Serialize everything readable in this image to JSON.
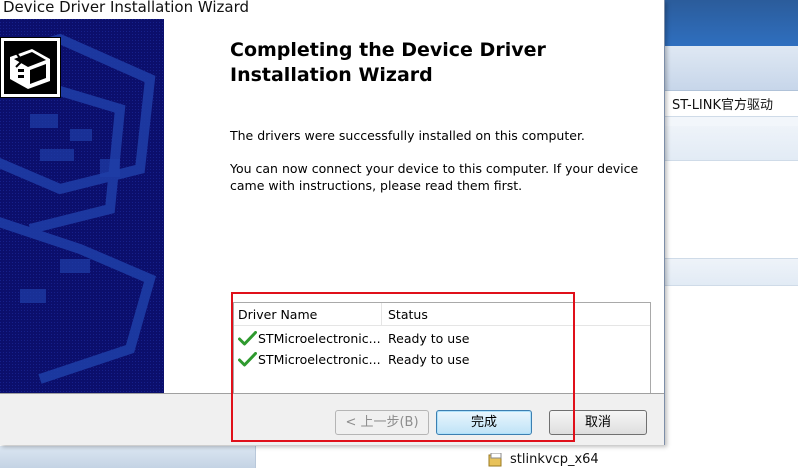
{
  "background": {
    "window_title": "ST-LINK官方驱动",
    "file_item": "stlinkvcp_x64"
  },
  "wizard": {
    "title": "Device Driver Installation Wizard",
    "heading": "Completing the Device Driver Installation Wizard",
    "paragraph1": "The drivers were successfully installed on this computer.",
    "paragraph2": "You can now connect your device to this computer. If your device came with instructions, please read them first.",
    "table": {
      "columns": [
        "Driver Name",
        "Status"
      ],
      "rows": [
        {
          "name": "STMicroelectronic...",
          "status": "Ready to use"
        },
        {
          "name": "STMicroelectronic...",
          "status": "Ready to use"
        }
      ]
    },
    "buttons": {
      "back": "< 上一步(B)",
      "finish": "完成",
      "cancel": "取消"
    }
  },
  "colors": {
    "sidebar": "#0b0f6c",
    "check": "#2f9a2f",
    "highlight": "#e0101a"
  },
  "icons": [
    "driver-box-icon",
    "checkmark-icon",
    "file-icon"
  ]
}
